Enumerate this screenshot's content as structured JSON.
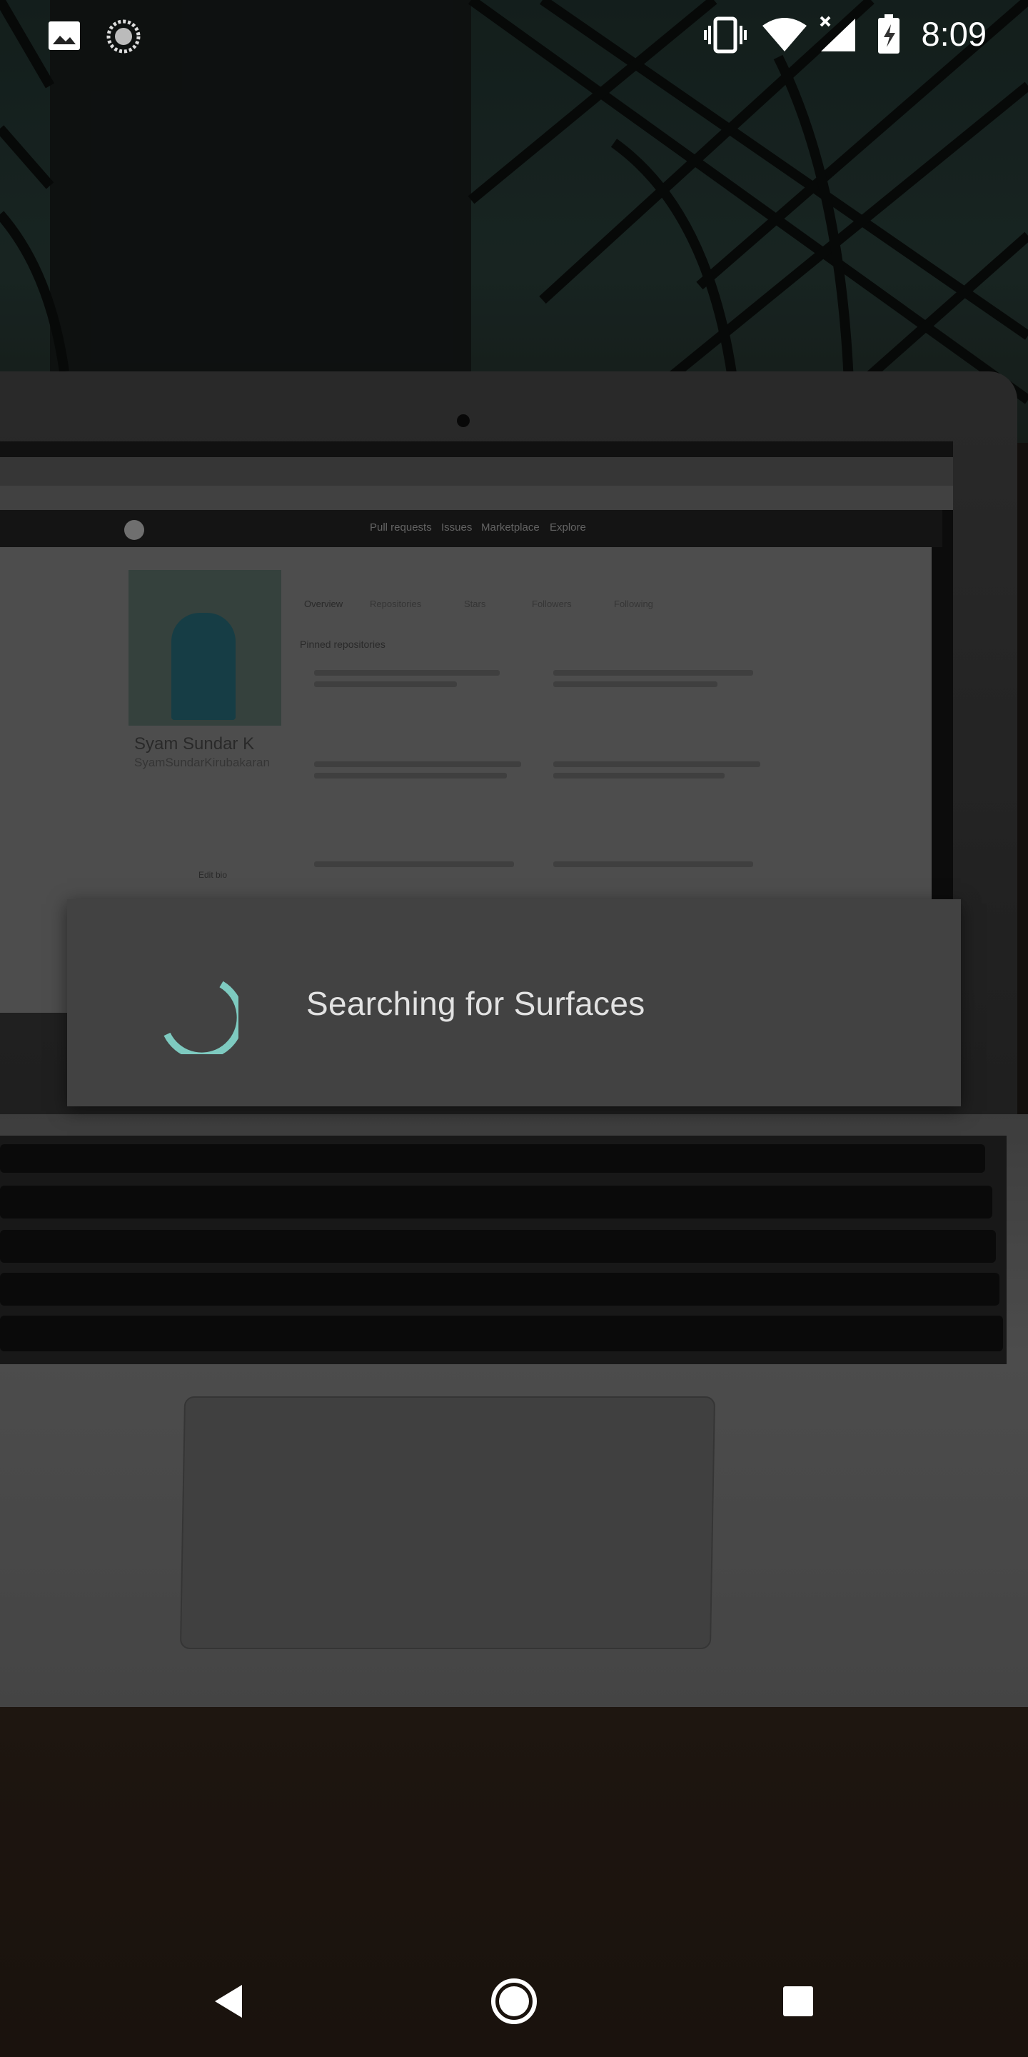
{
  "status_bar": {
    "time": "8:09",
    "icons": [
      "image-icon",
      "sync-icon",
      "vibrate-icon",
      "wifi-icon",
      "cell-signal-icon",
      "battery-charging-icon"
    ]
  },
  "dialog": {
    "message": "Searching for Surfaces",
    "spinner_color": "#7ecac0"
  },
  "background": {
    "laptop_screen": {
      "profile_name": "Syam Sundar K",
      "profile_handle": "SyamSundarKirubakaran",
      "nav_items": [
        "Pull requests",
        "Issues",
        "Marketplace",
        "Explore"
      ],
      "tabs": [
        "Overview",
        "Repositories",
        "Stars",
        "Followers",
        "Following"
      ],
      "section_title": "Pinned repositories",
      "edit_button": "Edit bio"
    }
  },
  "navigation_bar": {
    "buttons": [
      "back-button",
      "home-button",
      "recents-button"
    ]
  },
  "colors": {
    "dialog_background": "#424242",
    "dialog_text": "#e2e2e2",
    "spinner_accent": "#7ecac0"
  }
}
